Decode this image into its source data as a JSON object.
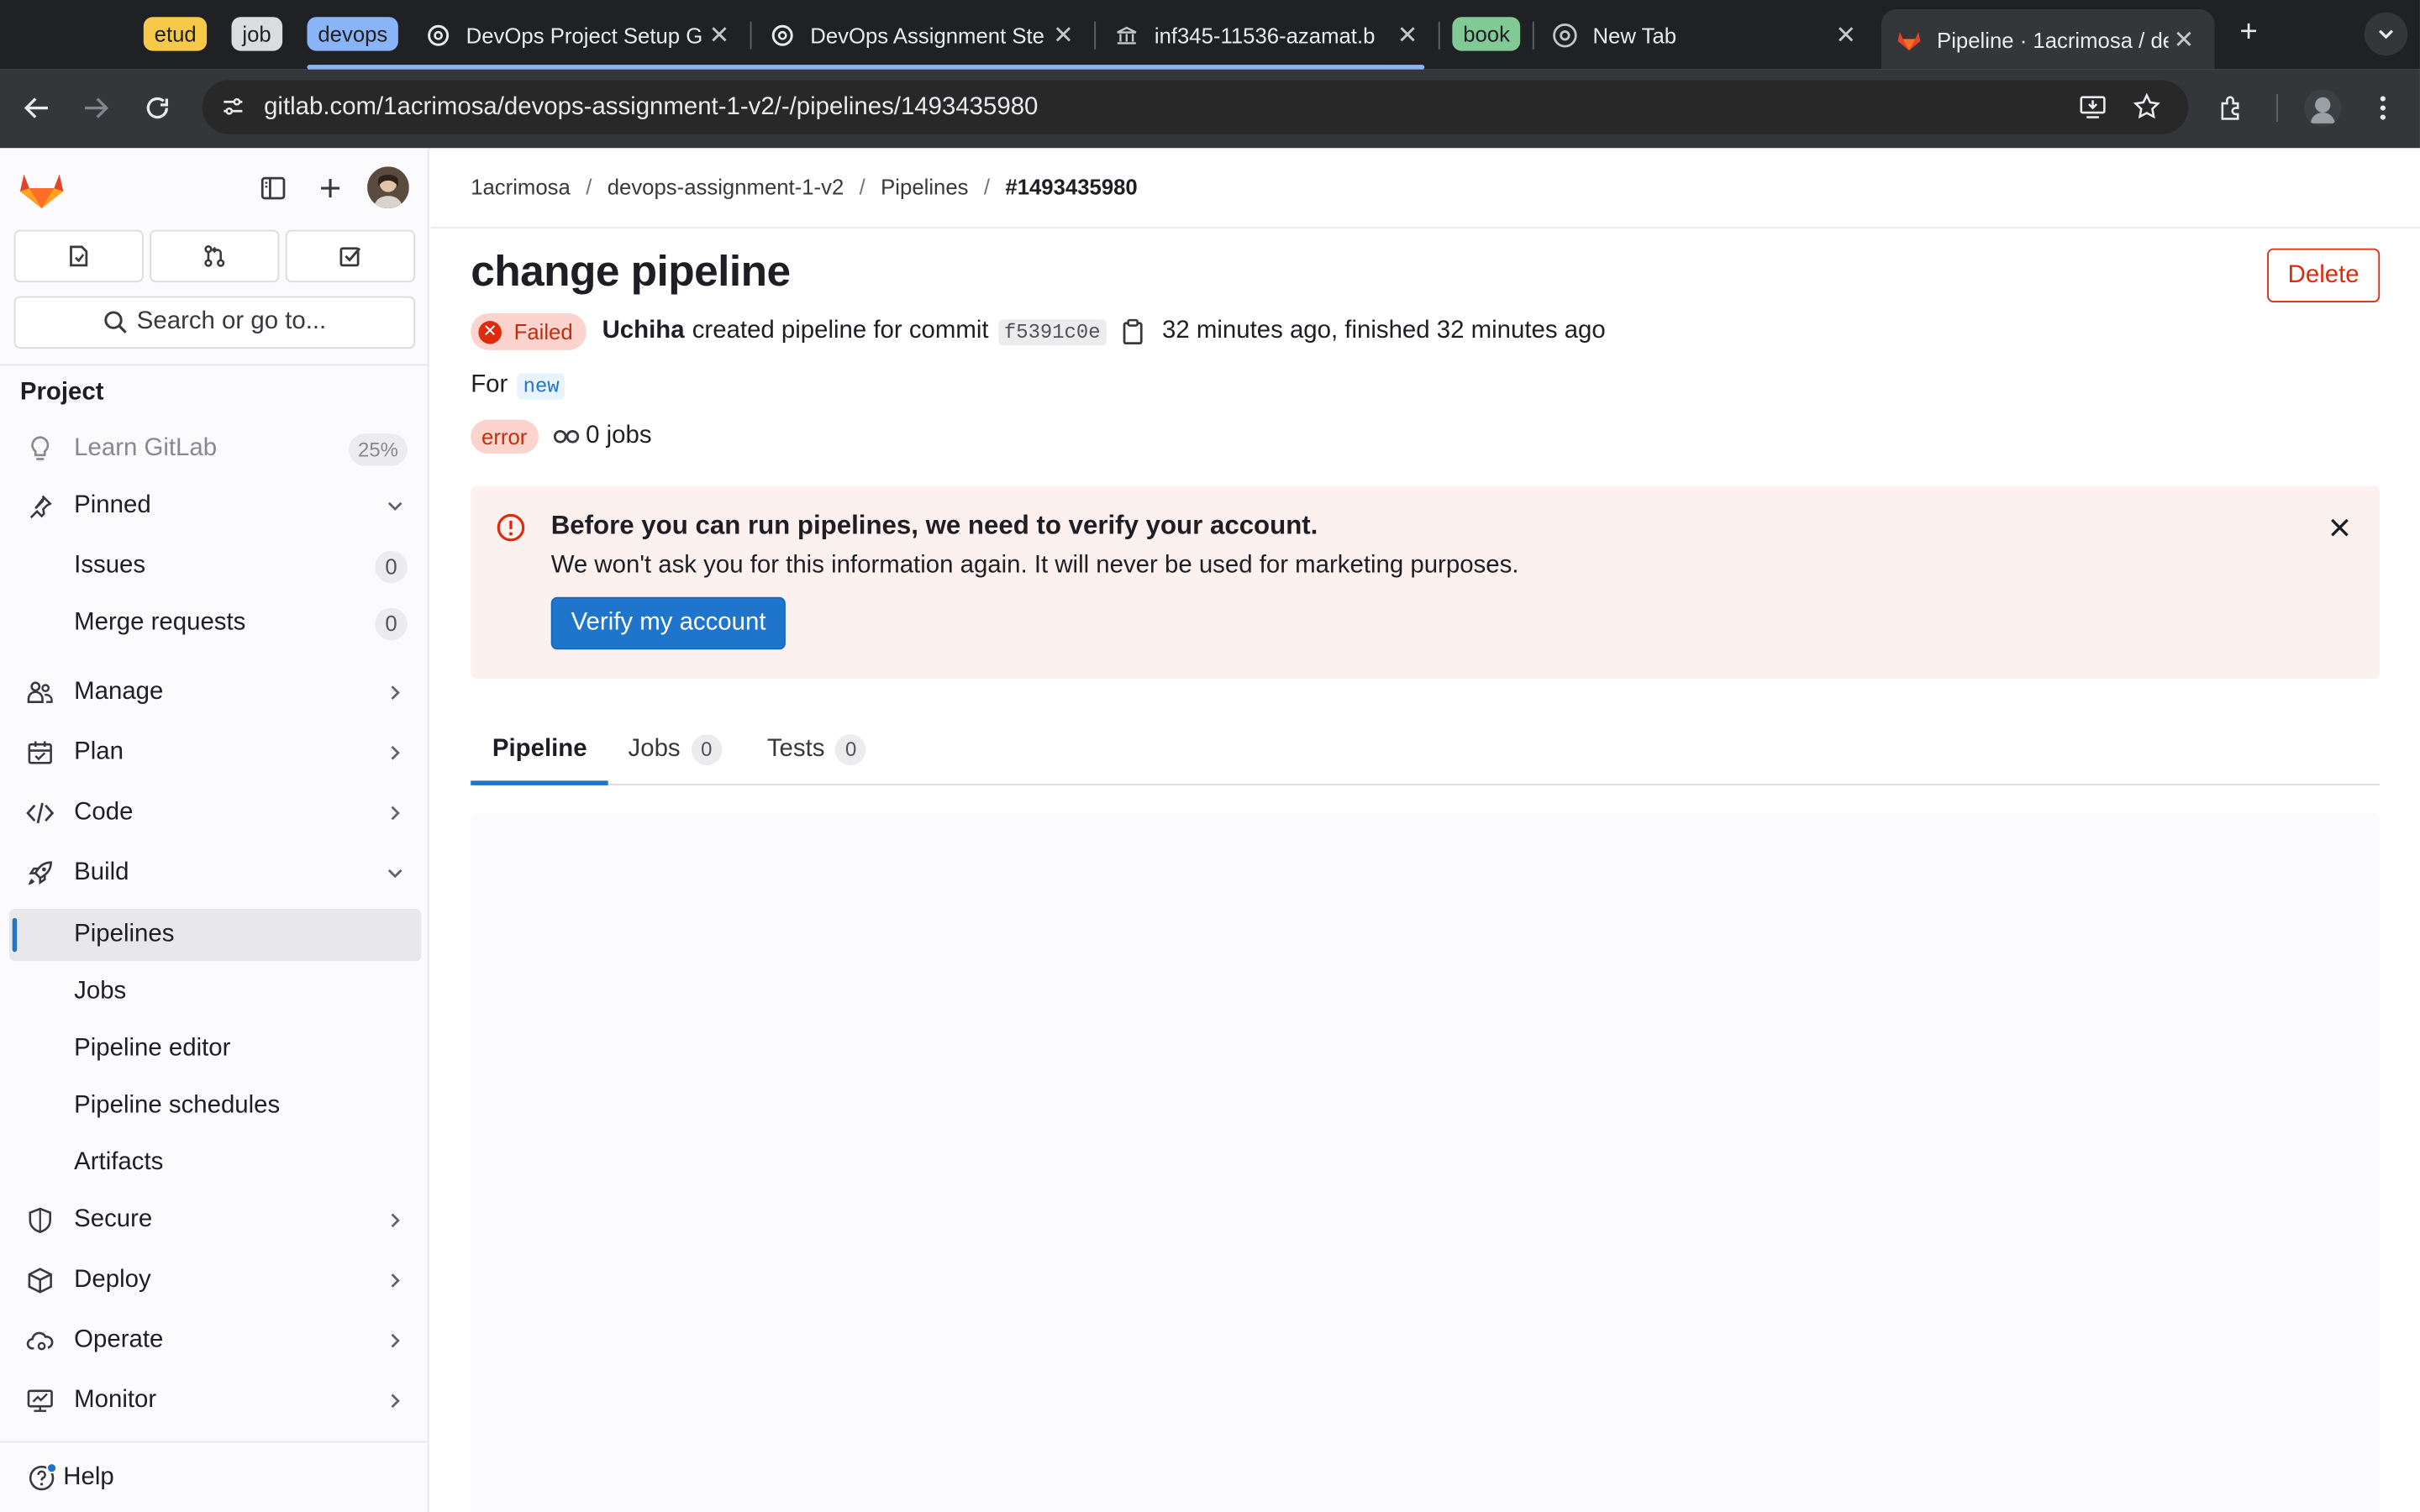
{
  "browser": {
    "groups": [
      {
        "label": "etud",
        "color": "#f7c948"
      },
      {
        "label": "job",
        "color": "#dadce0"
      },
      {
        "label": "devops",
        "color": "#8ab4f8"
      },
      {
        "label": "book",
        "color": "#81c995"
      }
    ],
    "tabs": [
      {
        "title": "DevOps Project Setup G"
      },
      {
        "title": "DevOps Assignment Ste"
      },
      {
        "title": "inf345-11536-azamat.b"
      },
      {
        "title": "New Tab"
      },
      {
        "title": "Pipeline · 1acrimosa / de"
      }
    ],
    "url": "gitlab.com/1acrimosa/devops-assignment-1-v2/-/pipelines/1493435980"
  },
  "sidebar": {
    "search_label": "Search or go to...",
    "section_title": "Project",
    "learn": {
      "label": "Learn GitLab",
      "progress": "25%"
    },
    "pinned": {
      "label": "Pinned"
    },
    "issues": {
      "label": "Issues",
      "count": "0"
    },
    "merge_requests": {
      "label": "Merge requests",
      "count": "0"
    },
    "manage": "Manage",
    "plan": "Plan",
    "code": "Code",
    "build": "Build",
    "build_items": {
      "pipelines": "Pipelines",
      "jobs": "Jobs",
      "pipeline_editor": "Pipeline editor",
      "pipeline_schedules": "Pipeline schedules",
      "artifacts": "Artifacts"
    },
    "secure": "Secure",
    "deploy": "Deploy",
    "operate": "Operate",
    "monitor": "Monitor",
    "help": "Help"
  },
  "breadcrumb": [
    "1acrimosa",
    "devops-assignment-1-v2",
    "Pipelines",
    "#1493435980"
  ],
  "pipeline": {
    "title": "change pipeline",
    "delete_label": "Delete",
    "status": "Failed",
    "user": "Uchiha",
    "created_text": "created pipeline for commit",
    "commit_sha": "f5391c0e",
    "time_text": "32 minutes ago, finished 32 minutes ago",
    "for_label": "For",
    "branch": "new",
    "error_badge": "error",
    "jobs_text": "0 jobs"
  },
  "alert": {
    "title": "Before you can run pipelines, we need to verify your account.",
    "body": "We won't ask you for this information again. It will never be used for marketing purposes.",
    "button": "Verify my account"
  },
  "tabs": {
    "pipeline": "Pipeline",
    "jobs": {
      "label": "Jobs",
      "count": "0"
    },
    "tests": {
      "label": "Tests",
      "count": "0"
    }
  },
  "colors": {
    "brand_orange": "#fc6d26",
    "accent_blue": "#1f75cb",
    "danger_red": "#dd2b0e",
    "alert_bg": "#fcf1ef"
  }
}
